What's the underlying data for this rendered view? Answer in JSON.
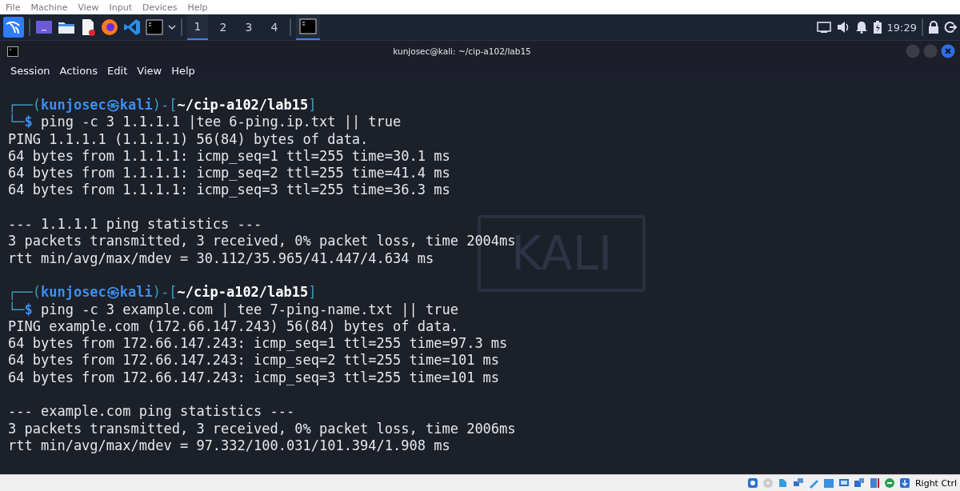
{
  "host_menu": [
    "File",
    "Machine",
    "View",
    "Input",
    "Devices",
    "Help"
  ],
  "panel": {
    "workspaces": [
      {
        "label": "1",
        "selected": true
      },
      {
        "label": "2",
        "selected": false
      },
      {
        "label": "3",
        "selected": false
      },
      {
        "label": "4",
        "selected": false
      }
    ],
    "clock": "19:29"
  },
  "window": {
    "title": "kunjosec@kali: ~/cip-a102/lab15",
    "menu": [
      "Session",
      "Actions",
      "Edit",
      "View",
      "Help"
    ]
  },
  "wallpaper_logo": "KALI",
  "terminal": [
    {
      "kind": "prompt",
      "open": "┌──(",
      "user": "kunjosec",
      "symbol": "㉿",
      "host": "kali",
      "mid": ")-[",
      "path": "~/cip-a102/lab15",
      "close": "]",
      "corner": "└─",
      "sigil": "$",
      "command": "ping -c 3 1.1.1.1 |tee 6-ping.ip.txt || true"
    },
    {
      "kind": "output",
      "text": "PING 1.1.1.1 (1.1.1.1) 56(84) bytes of data."
    },
    {
      "kind": "output",
      "text": "64 bytes from 1.1.1.1: icmp_seq=1 ttl=255 time=30.1 ms"
    },
    {
      "kind": "output",
      "text": "64 bytes from 1.1.1.1: icmp_seq=2 ttl=255 time=41.4 ms"
    },
    {
      "kind": "output",
      "text": "64 bytes from 1.1.1.1: icmp_seq=3 ttl=255 time=36.3 ms"
    },
    {
      "kind": "blank"
    },
    {
      "kind": "output",
      "text": "--- 1.1.1.1 ping statistics ---"
    },
    {
      "kind": "output",
      "text": "3 packets transmitted, 3 received, 0% packet loss, time 2004ms"
    },
    {
      "kind": "output",
      "text": "rtt min/avg/max/mdev = 30.112/35.965/41.447/4.634 ms"
    },
    {
      "kind": "blank"
    },
    {
      "kind": "prompt",
      "open": "┌──(",
      "user": "kunjosec",
      "symbol": "㉿",
      "host": "kali",
      "mid": ")-[",
      "path": "~/cip-a102/lab15",
      "close": "]",
      "corner": "└─",
      "sigil": "$",
      "command": "ping -c 3 example.com | tee 7-ping-name.txt || true"
    },
    {
      "kind": "output",
      "text": "PING example.com (172.66.147.243) 56(84) bytes of data."
    },
    {
      "kind": "output",
      "text": "64 bytes from 172.66.147.243: icmp_seq=1 ttl=255 time=97.3 ms"
    },
    {
      "kind": "output",
      "text": "64 bytes from 172.66.147.243: icmp_seq=2 ttl=255 time=101 ms"
    },
    {
      "kind": "output",
      "text": "64 bytes from 172.66.147.243: icmp_seq=3 ttl=255 time=101 ms"
    },
    {
      "kind": "blank"
    },
    {
      "kind": "output",
      "text": "--- example.com ping statistics ---"
    },
    {
      "kind": "output",
      "text": "3 packets transmitted, 3 received, 0% packet loss, time 2006ms"
    },
    {
      "kind": "output",
      "text": "rtt min/avg/max/mdev = 97.332/100.031/101.394/1.908 ms"
    }
  ],
  "host_status": {
    "key": "Right Ctrl"
  }
}
